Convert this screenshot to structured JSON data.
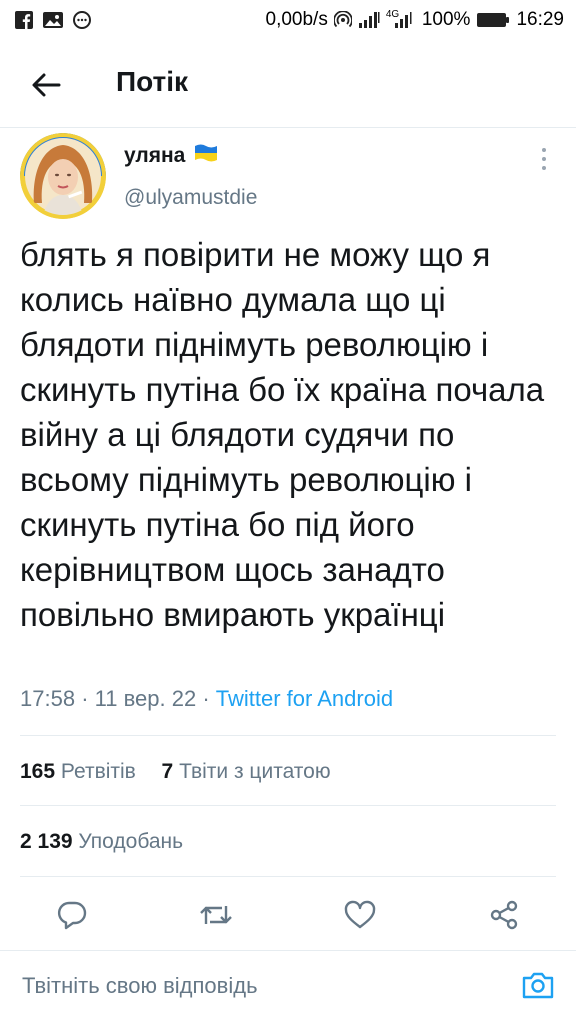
{
  "status_bar": {
    "left_icons": [
      "facebook-icon",
      "gallery-icon",
      "chat-icon"
    ],
    "network_speed": "0,00b/s",
    "network_type": "4G",
    "battery_percent": "100%",
    "time": "16:29"
  },
  "header": {
    "back_icon": "arrow-left-icon",
    "title": "Потік"
  },
  "tweet": {
    "author": {
      "display_name": "уляна",
      "flag_icon": "ukraine-flag-icon",
      "handle": "@ulyamustdie"
    },
    "text": "блять я повірити не можу що я колись наївно думала що ці блядоти піднімуть революцію і скинуть путіна бо їх країна почала війну а ці блядоти судячи по всьому піднімуть революцію і скинуть путіна бо під його керівництвом щось занадто повільно вмирають українці",
    "time": "17:58",
    "date": "11 вер. 22",
    "separator": "·",
    "source": "Twitter for Android",
    "retweets_count": "165",
    "retweets_label": "Ретвітів",
    "quotes_count": "7",
    "quotes_label": "Твіти з цитатою",
    "likes_count": "2 139",
    "likes_label": "Уподобань"
  },
  "actions": [
    "reply-icon",
    "retweet-icon",
    "like-icon",
    "share-icon"
  ],
  "reply": {
    "placeholder": "Твітніть свою відповідь",
    "camera_icon": "camera-icon"
  },
  "colors": {
    "accent": "#1da1f2",
    "secondary_text": "#657786",
    "divider": "#e6ecf0"
  }
}
